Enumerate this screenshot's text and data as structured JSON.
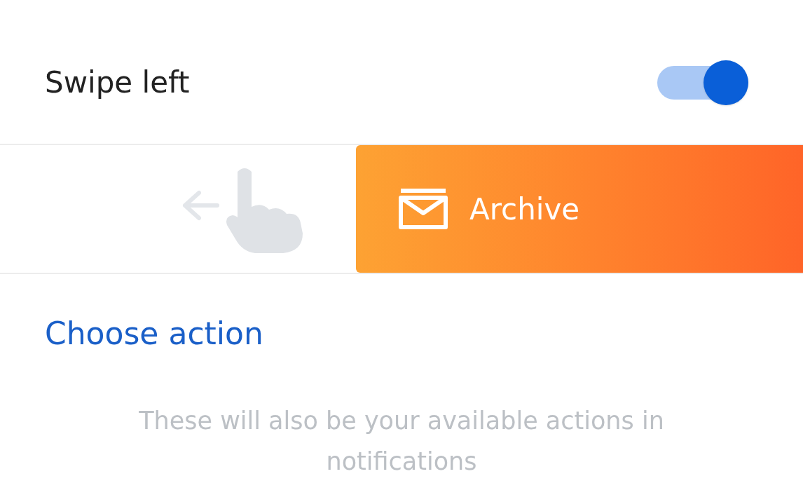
{
  "setting": {
    "label": "Swipe left",
    "on": true
  },
  "preview": {
    "action": {
      "label": "Archive"
    }
  },
  "choose_action": {
    "label": "Choose action"
  },
  "note": "These will also be your available actions in notifications"
}
